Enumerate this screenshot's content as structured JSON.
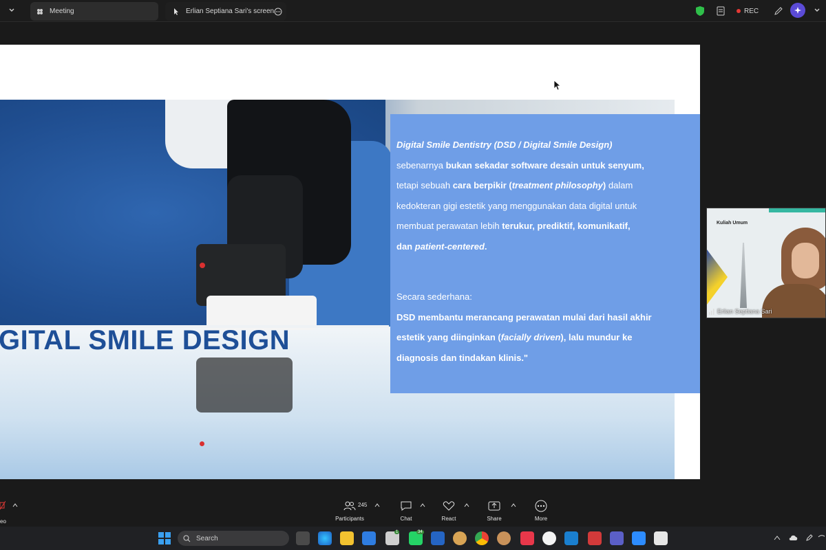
{
  "topbar": {
    "tabs": [
      {
        "label": "Meeting"
      },
      {
        "label": "Erlian Septiana Sari's screen"
      }
    ],
    "rec_label": "REC"
  },
  "slide": {
    "title": "GITAL SMILE DESIGN",
    "textbox": {
      "p1_seg1": "Digital Smile Dentistry (DSD / Digital Smile Design)",
      "p1_seg2": "sebenarnya",
      "p1_seg3": "bukan sekadar software desain untuk senyum,",
      "p1_seg4": "tetapi sebuah",
      "p1_seg5": "cara berpikir (",
      "p1_seg6": "treatment philosophy",
      "p1_seg7": ")",
      "p1_seg8": "dalam",
      "p1_seg9": "kedokteran gigi estetik yang menggunakan data digital untuk",
      "p1_seg10": "membuat perawatan lebih",
      "p1_seg11": "terukur, prediktif, komunikatif,",
      "p1_seg12": "dan",
      "p1_seg13": "patient-centered",
      "p1_seg14": ".",
      "p2_seg1": "Secara sederhana:",
      "p2_seg2": "DSD membantu merancang perawatan mulai dari hasil akhir",
      "p2_seg3": "estetik yang diinginkan (",
      "p2_seg4": "facially driven",
      "p2_seg5": "), lalu mundur ke",
      "p2_seg6": "diagnosis dan tindakan klinis.\""
    }
  },
  "video": {
    "name": "Erlian Septiana Sari",
    "slide_heading": "Kuliah Umum"
  },
  "controls": {
    "participants_count": "245",
    "participants": "Participants",
    "chat": "Chat",
    "react": "React",
    "share": "Share",
    "more": "More",
    "left_label": "eo"
  },
  "taskbar": {
    "search_placeholder": "Search",
    "badge1": "1",
    "badge2": "34"
  }
}
